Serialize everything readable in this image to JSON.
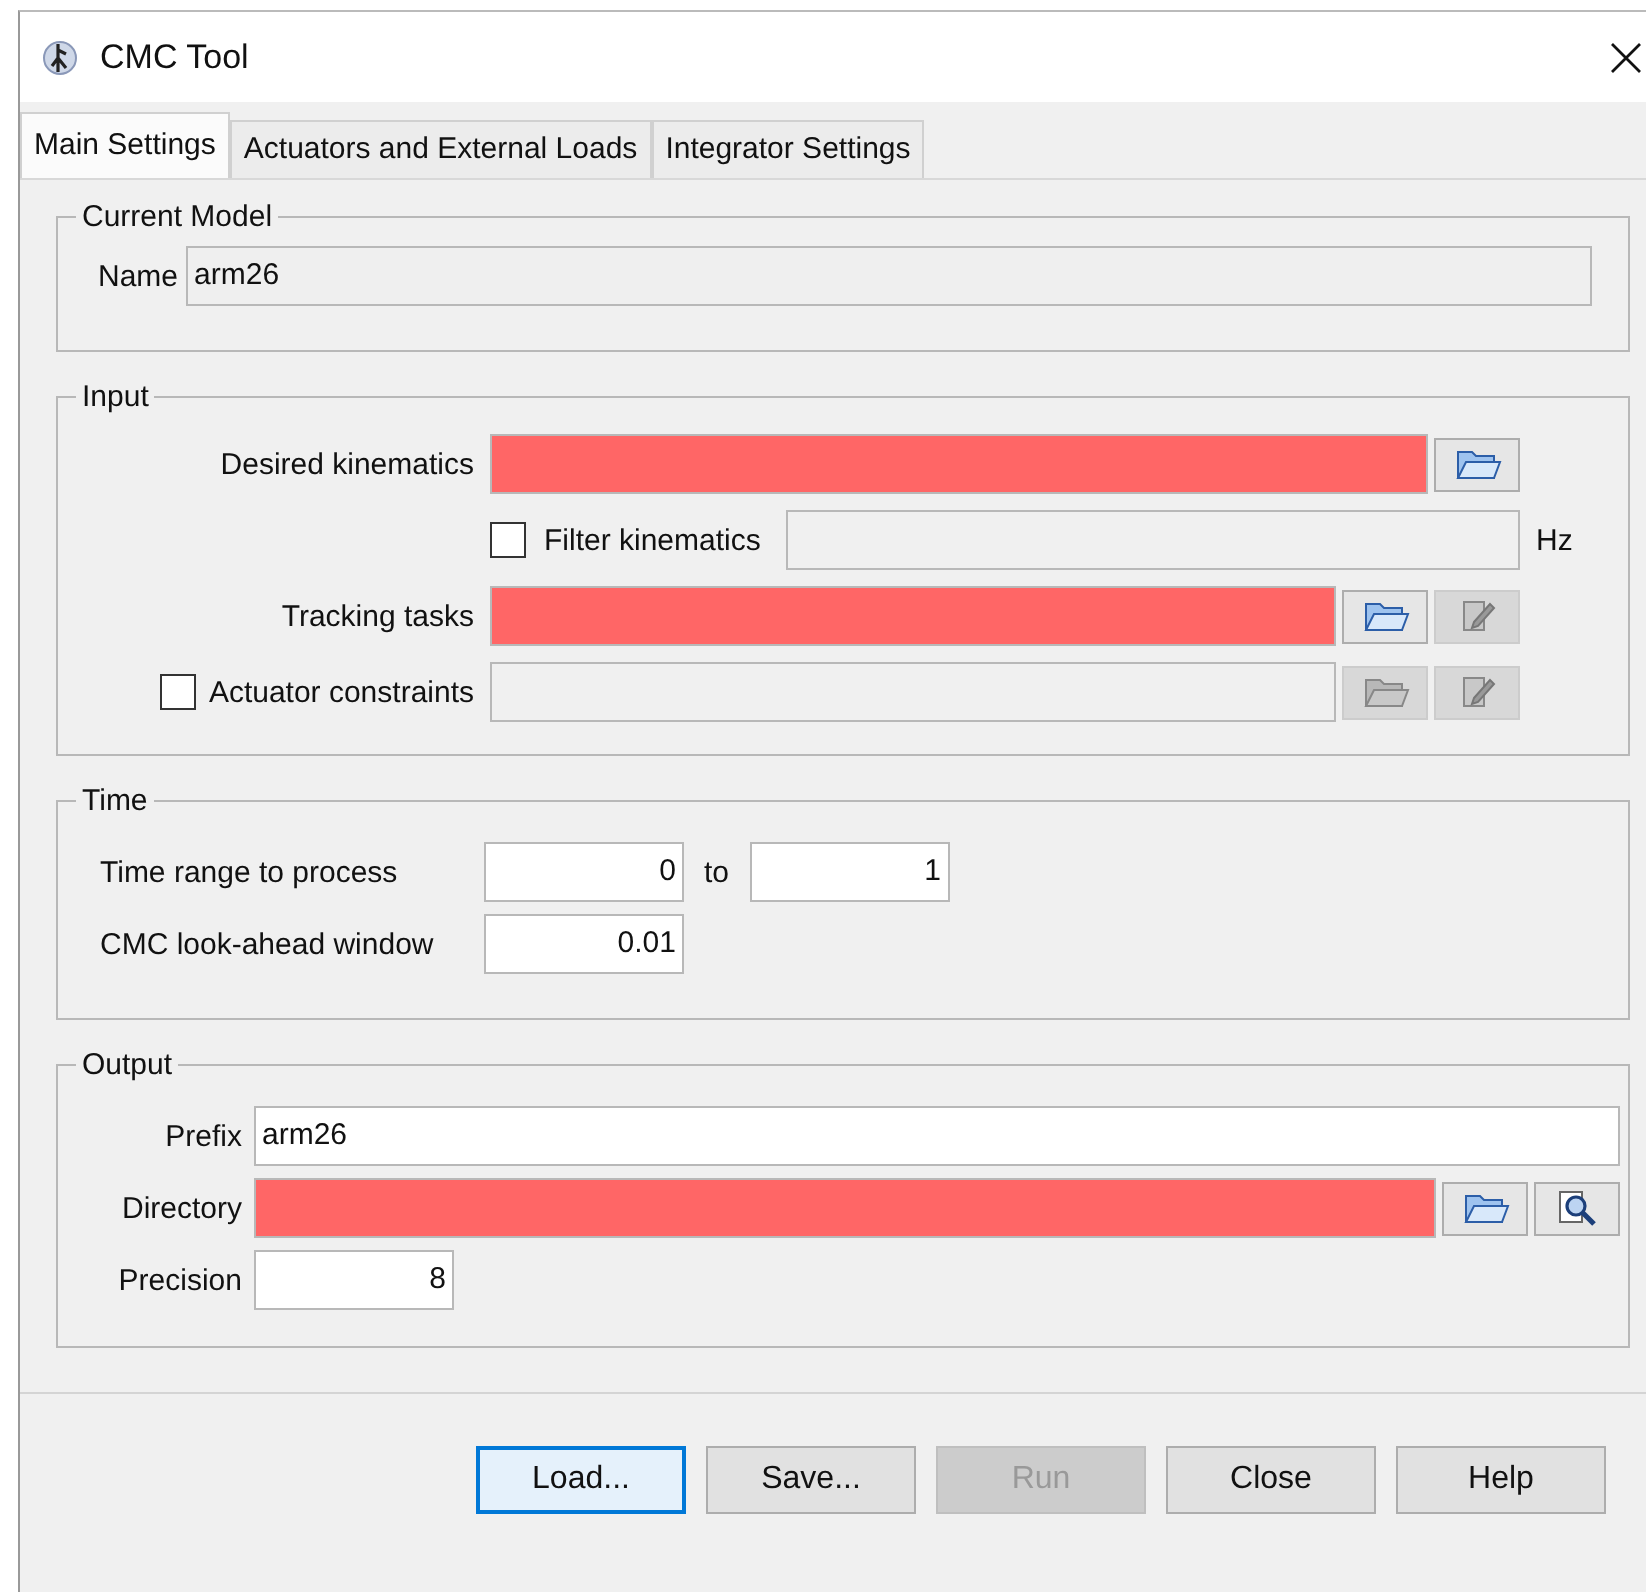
{
  "window": {
    "title": "CMC Tool"
  },
  "tabs": [
    {
      "label": "Main Settings",
      "selected": true
    },
    {
      "label": "Actuators and External Loads",
      "selected": false
    },
    {
      "label": "Integrator Settings",
      "selected": false
    }
  ],
  "current_model": {
    "title": "Current Model",
    "name_label": "Name",
    "name_value": "arm26"
  },
  "input": {
    "title": "Input",
    "rows": [
      {
        "kind": "file",
        "label": "Desired kinematics",
        "invalid": true,
        "disabled": false,
        "tools": [
          {
            "kind": "open",
            "disabled": false
          }
        ]
      },
      {
        "kind": "filter",
        "label": "Filter kinematics",
        "checked": false,
        "disabled": true,
        "unit": "Hz"
      },
      {
        "kind": "file",
        "label": "Tracking tasks",
        "invalid": true,
        "disabled": false,
        "tools": [
          {
            "kind": "open",
            "disabled": false
          },
          {
            "kind": "edit",
            "disabled": true
          }
        ]
      },
      {
        "kind": "check_file",
        "label": "Actuator constraints",
        "checked": false,
        "invalid": false,
        "disabled": true,
        "tools": [
          {
            "kind": "open",
            "disabled": true
          },
          {
            "kind": "edit",
            "disabled": true
          }
        ]
      }
    ]
  },
  "time": {
    "title": "Time",
    "range_label": "Time range to process",
    "from": "0",
    "to_label": "to",
    "to": "1",
    "window_label": "CMC look-ahead window",
    "window": "0.01"
  },
  "output": {
    "title": "Output",
    "prefix_label": "Prefix",
    "prefix": "arm26",
    "directory_label": "Directory",
    "directory_invalid": true,
    "directory_tools": [
      {
        "kind": "open",
        "disabled": false
      },
      {
        "kind": "browse",
        "disabled": false
      }
    ],
    "precision_label": "Precision",
    "precision": "8"
  },
  "buttons": [
    {
      "label": "Load...",
      "focused": true,
      "disabled": false
    },
    {
      "label": "Save...",
      "focused": false,
      "disabled": false
    },
    {
      "label": "Run",
      "focused": false,
      "disabled": true
    },
    {
      "label": "Close",
      "focused": false,
      "disabled": false
    },
    {
      "label": "Help",
      "focused": false,
      "disabled": false
    }
  ]
}
